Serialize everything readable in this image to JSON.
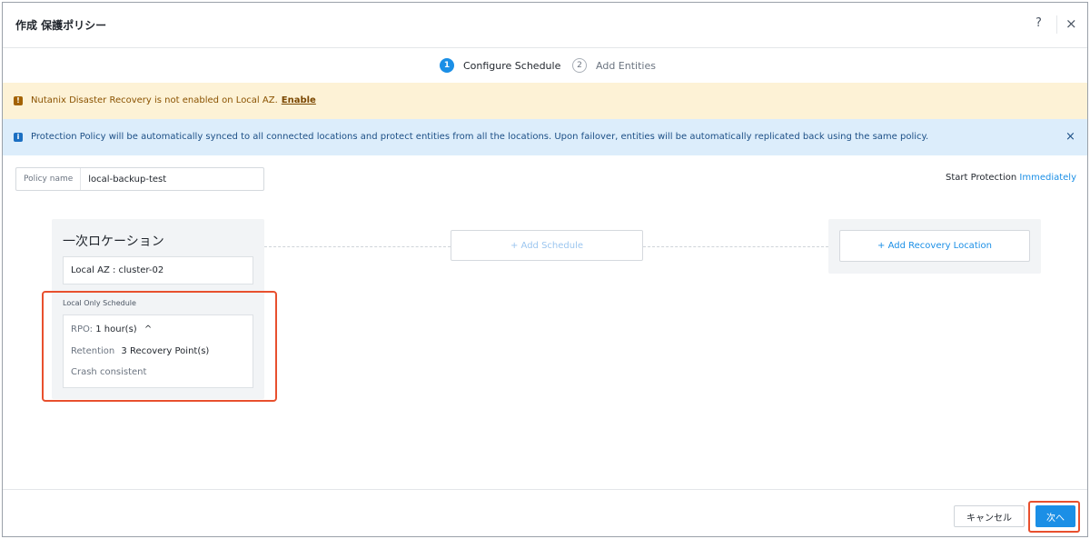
{
  "header": {
    "title": "作成 保護ポリシー",
    "help_label": "?",
    "close_label": "×"
  },
  "steps": [
    {
      "number": "1",
      "label": "Configure Schedule"
    },
    {
      "number": "2",
      "label": "Add Entities"
    }
  ],
  "warning": {
    "icon": "!",
    "text": "Nutanix Disaster Recovery is not enabled on Local AZ.",
    "link": "Enable"
  },
  "info": {
    "icon": "i",
    "text": "Protection Policy will be automatically synced to all connected locations and protect entities from all the locations. Upon failover, entities will be automatically replicated back using the same policy.",
    "close_label": "×"
  },
  "policy": {
    "name_label": "Policy name",
    "name_value": "local-backup-test"
  },
  "start_protection": {
    "label": "Start Protection",
    "value": "Immediately"
  },
  "primary": {
    "title": "一次ロケーション",
    "location": "Local AZ : cluster-02",
    "schedule_label": "Local Only Schedule",
    "rpo_label": "RPO:",
    "rpo_value": "1 hour(s)",
    "rpo_toggle": "^",
    "retention_label": "Retention",
    "retention_value": "3 Recovery Point(s)",
    "consistency": "Crash consistent"
  },
  "add_schedule": "+ Add Schedule",
  "add_recovery": "+ Add Recovery Location",
  "footer": {
    "cancel": "キャンセル",
    "next": "次へ"
  },
  "colors": {
    "accent": "#1b8fe6",
    "highlight": "#e8502e",
    "warning_bg": "#fdf2d6",
    "info_bg": "#dcedfb"
  }
}
